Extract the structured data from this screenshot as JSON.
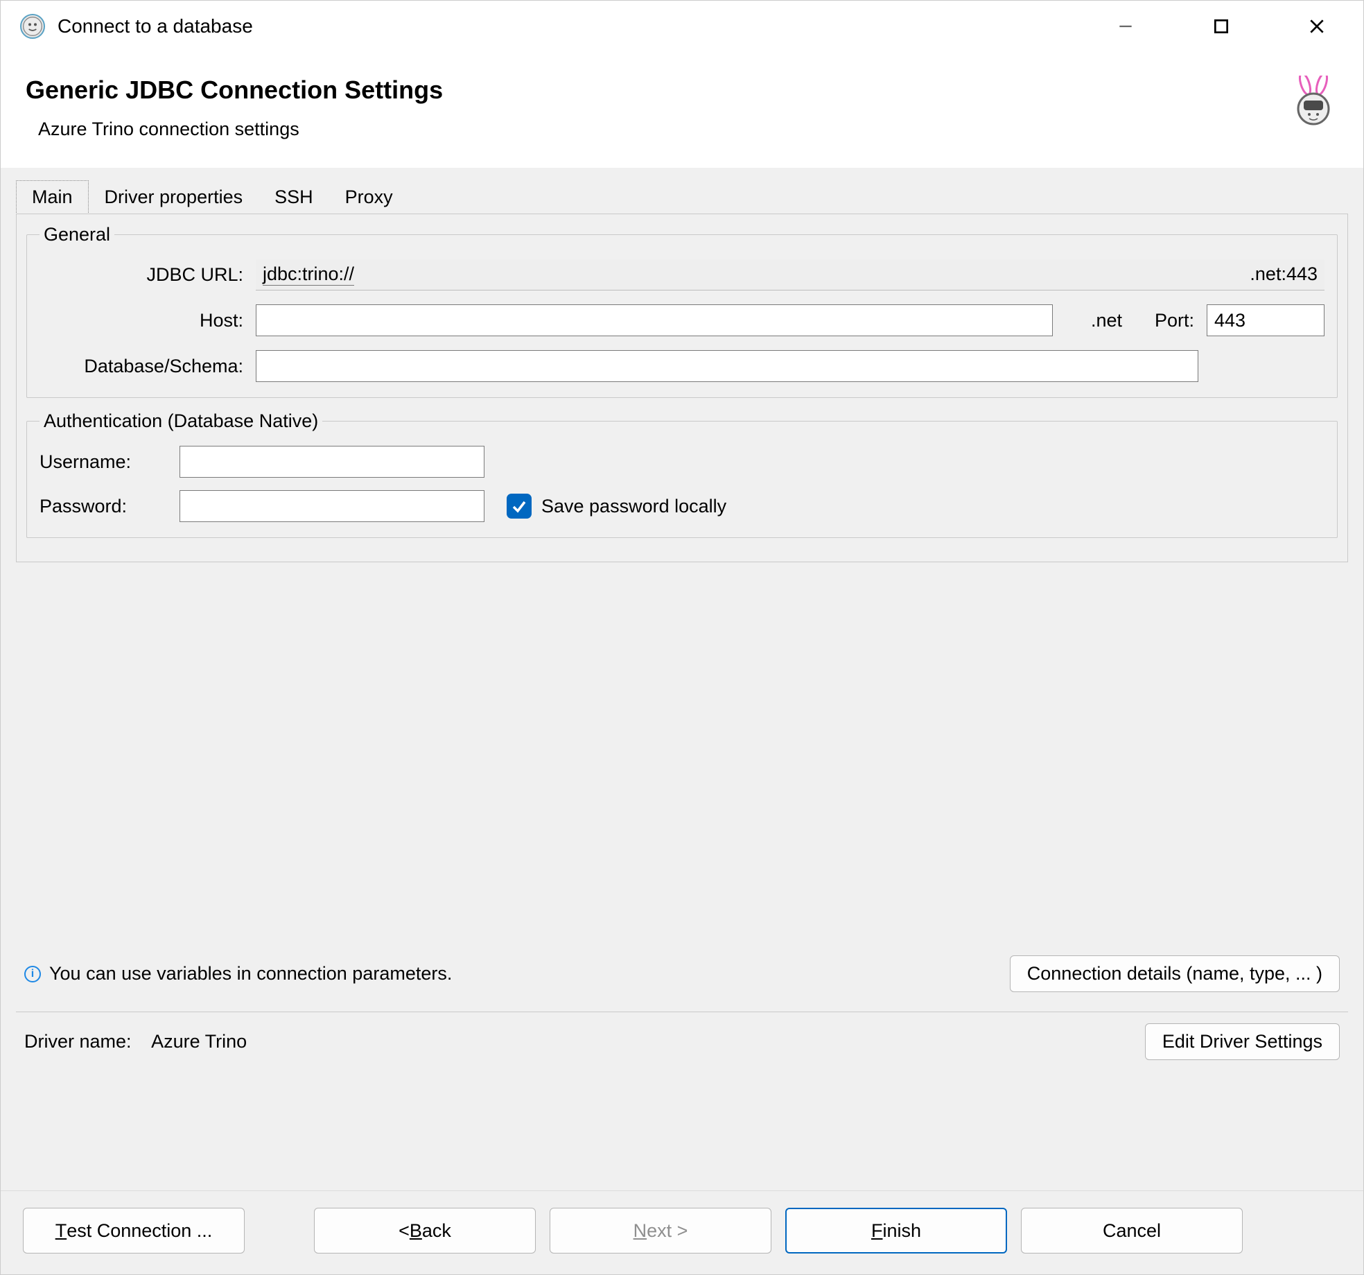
{
  "window": {
    "title": "Connect to a database"
  },
  "header": {
    "title": "Generic JDBC Connection Settings",
    "subtitle": "Azure Trino connection settings"
  },
  "tabs": [
    "Main",
    "Driver properties",
    "SSH",
    "Proxy"
  ],
  "active_tab_index": 0,
  "general": {
    "legend": "General",
    "jdbc_url_label": "JDBC URL:",
    "jdbc_url_prefix": "jdbc:trino://",
    "jdbc_url_suffix": ".net:443",
    "host_label": "Host:",
    "host_value": "",
    "host_domain_suffix": ".net",
    "port_label": "Port:",
    "port_value": "443",
    "db_label": "Database/Schema:",
    "db_value": ""
  },
  "auth": {
    "legend": "Authentication (Database Native)",
    "username_label": "Username:",
    "username_value": "",
    "password_label": "Password:",
    "password_value": "",
    "save_password_label": "Save password locally",
    "save_password_checked": true
  },
  "info": {
    "hint": "You can use variables in connection parameters.",
    "connection_details_btn": "Connection details (name, type, ... )"
  },
  "driver": {
    "label": "Driver name:",
    "name": "Azure Trino",
    "edit_btn": "Edit Driver Settings"
  },
  "footer": {
    "test": "Test Connection ...",
    "back_prefix": "< ",
    "back_letter": "B",
    "back_rest": "ack",
    "next_letter": "N",
    "next_rest": "ext >",
    "finish_letter": "F",
    "finish_rest": "inish",
    "cancel": "Cancel"
  }
}
